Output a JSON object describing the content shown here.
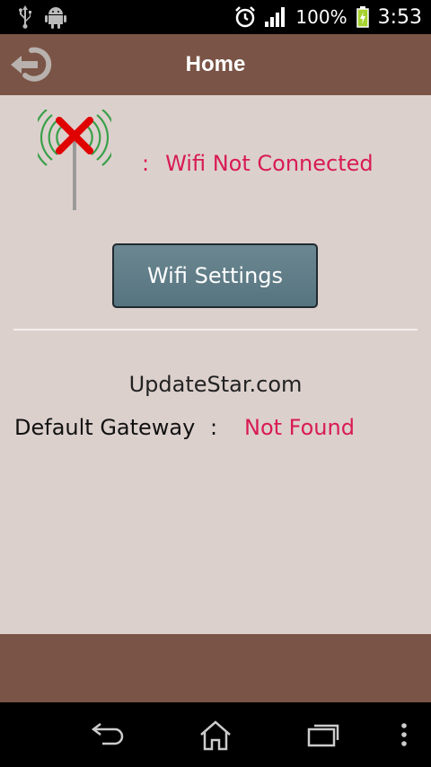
{
  "status_bar": {
    "battery_percent": "100%",
    "time": "3:53",
    "icons": [
      "usb-icon",
      "android-debug-icon",
      "alarm-icon",
      "signal-icon",
      "battery-charging-icon"
    ]
  },
  "header": {
    "title": "Home",
    "back_icon": "back-refresh-icon"
  },
  "wifi": {
    "colon": ":",
    "status": "Wifi Not Connected",
    "icon": "wifi-disconnected-icon"
  },
  "buttons": {
    "wifi_settings": "Wifi Settings"
  },
  "site": {
    "label": "UpdateStar.com"
  },
  "gateway": {
    "label": "Default Gateway",
    "colon": ":",
    "value": "Not Found"
  },
  "navigation": {
    "icons": [
      "back-icon",
      "home-icon",
      "recent-apps-icon",
      "menu-icon"
    ]
  },
  "colors": {
    "header": "#7a5446",
    "content_bg": "#dcd0cd",
    "accent_red": "#d81b55",
    "button": "#5f7c87"
  }
}
